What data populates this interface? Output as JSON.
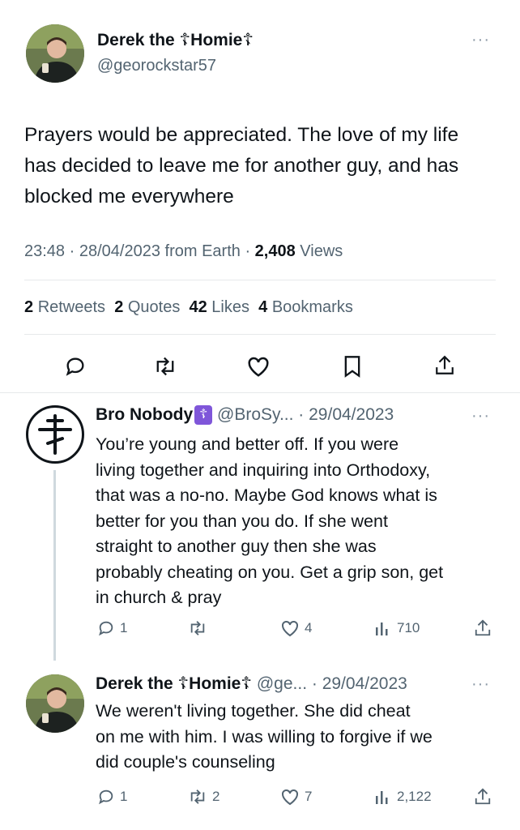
{
  "tweet": {
    "author_name": "Derek the ☦Homie☦",
    "handle": "@georockstar57",
    "more": "···",
    "text": "Prayers would be appreciated. The love of my life has decided to leave me for another guy, and has blocked me everywhere",
    "time": "23:48",
    "date": "28/04/2023",
    "source": "from Earth",
    "views_count": "2,408",
    "views_label": "Views",
    "stats": {
      "retweets_count": "2",
      "retweets_label": "Retweets",
      "quotes_count": "2",
      "quotes_label": "Quotes",
      "likes_count": "42",
      "likes_label": "Likes",
      "bookmarks_count": "4",
      "bookmarks_label": "Bookmarks"
    },
    "actions": [
      "reply-icon",
      "retweet-icon",
      "like-icon",
      "bookmark-icon",
      "share-icon"
    ]
  },
  "replies": [
    {
      "author_name": "Bro Nobody",
      "badge": "☦",
      "handle": "@BroSy...",
      "date": "· 29/04/2023",
      "more": "···",
      "lines": [
        "You’re young and better off. If you were",
        "living together and inquiring into Orthodoxy,",
        "that was a no-no. Maybe God knows what is",
        "better for you than you do. If she went",
        "straight to another guy then she was",
        "probably cheating on you. Get a grip son, get",
        "in church & pray"
      ],
      "replies_count": "1",
      "retweets_count": "",
      "likes_count": "4",
      "views_count": "710"
    },
    {
      "author_name": "Derek the ☦Homie☦",
      "handle": "@ge...",
      "date": "· 29/04/2023",
      "more": "···",
      "lines": [
        "We weren't living together. She did cheat",
        "on me with him. I was willing to forgive if we",
        "did couple's counseling"
      ],
      "replies_count": "1",
      "retweets_count": "2",
      "likes_count": "7",
      "views_count": "2,122"
    }
  ],
  "colors": {
    "text": "#0f1419",
    "muted": "#536471",
    "divider": "#e7e9ea",
    "badge": "#7f56d9"
  }
}
